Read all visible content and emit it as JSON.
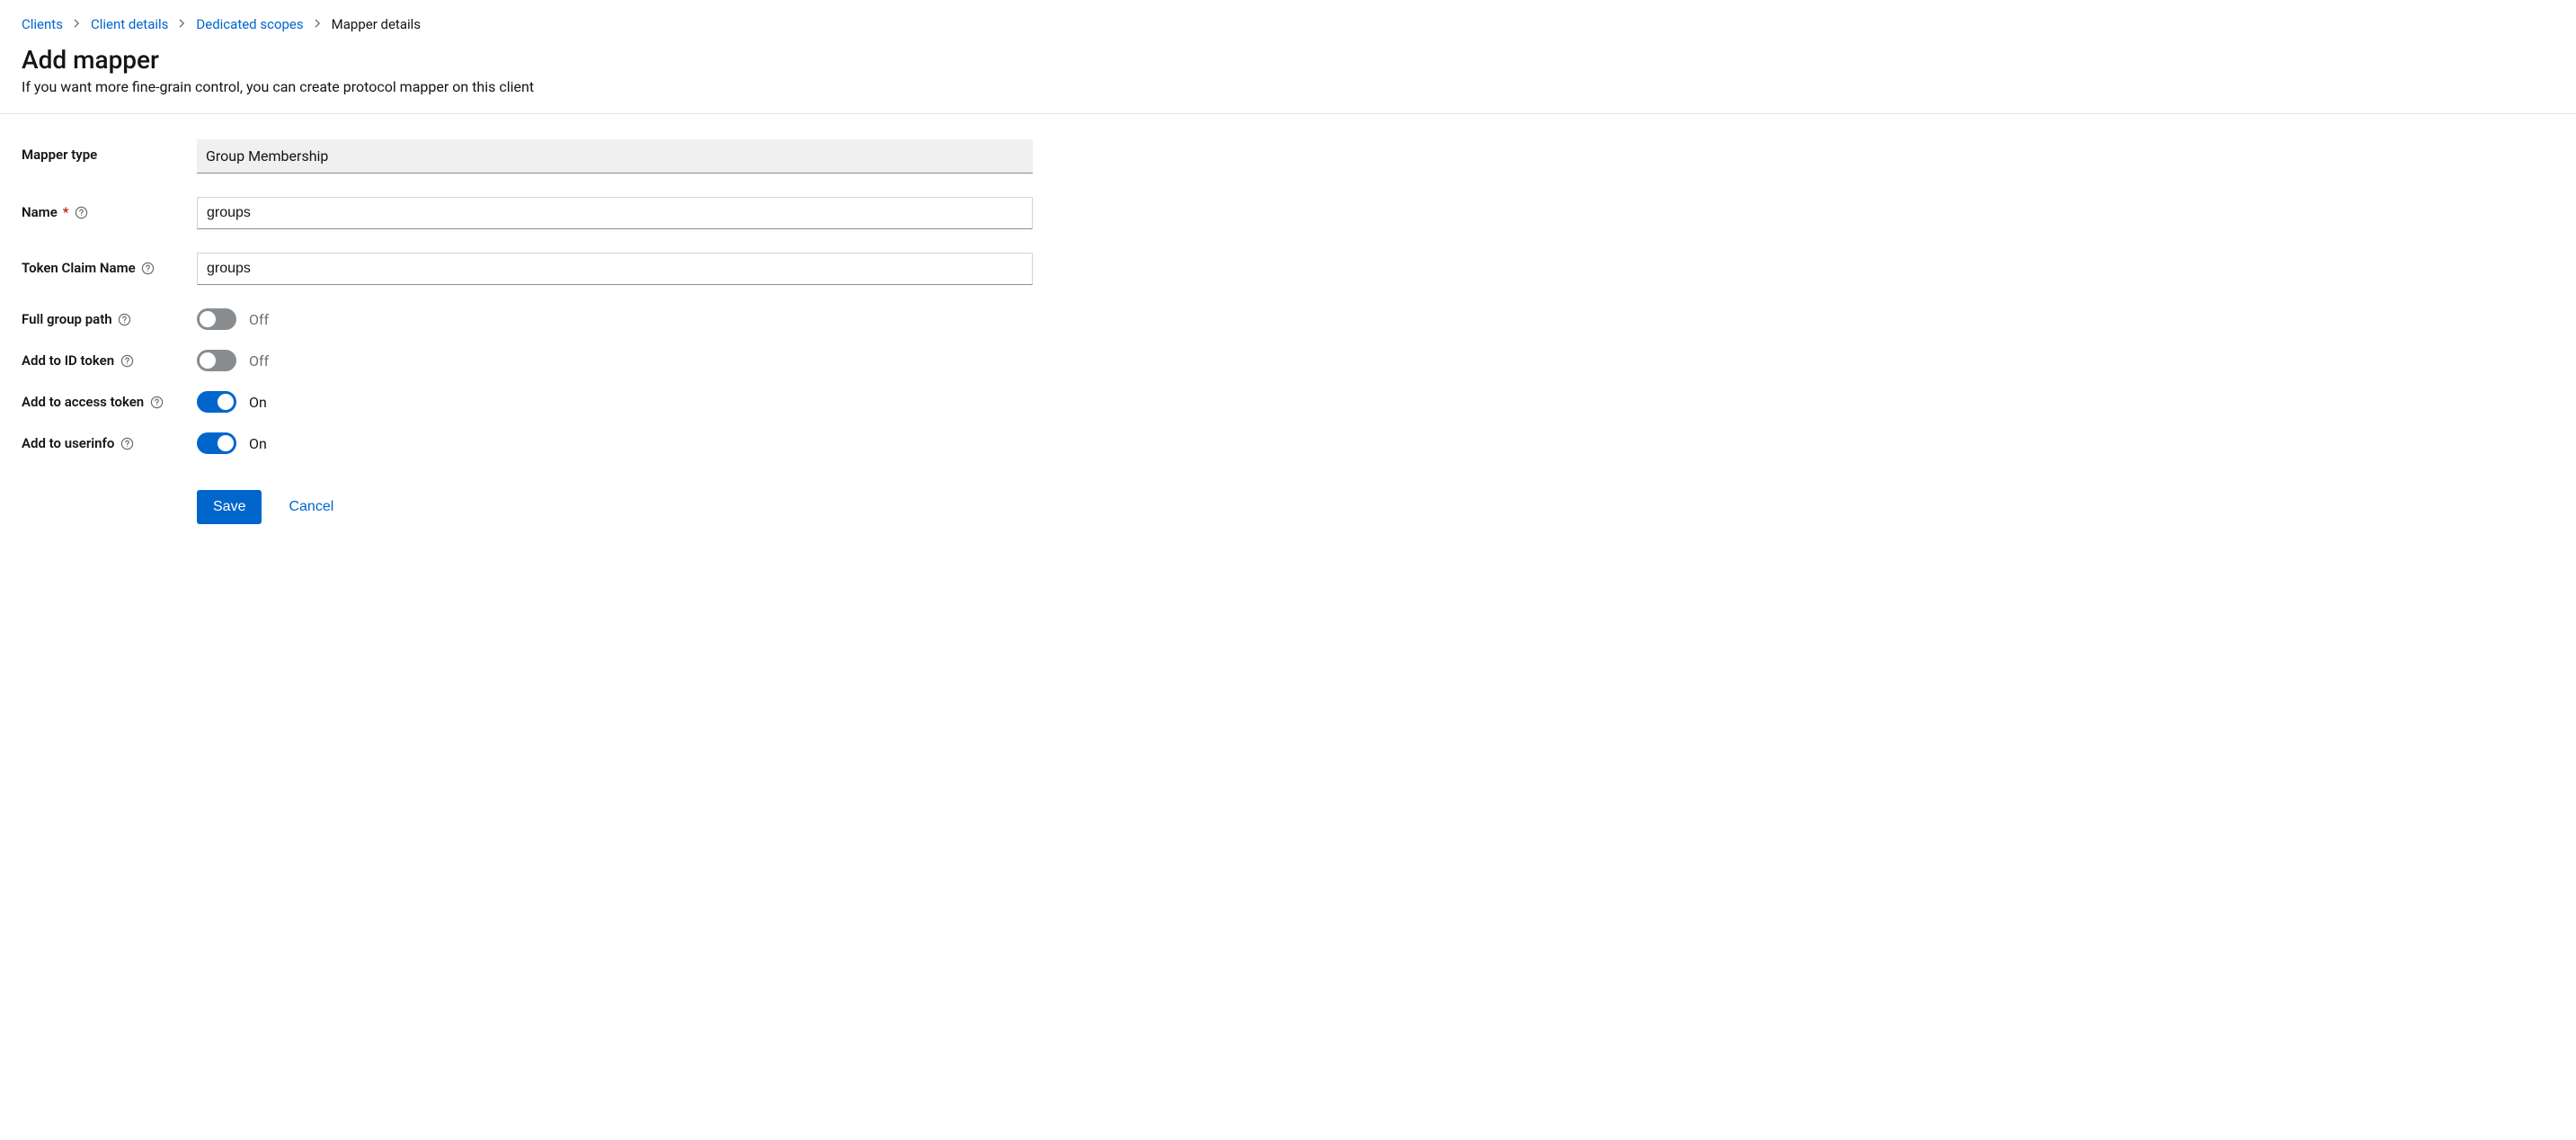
{
  "breadcrumb": {
    "items": [
      {
        "label": "Clients"
      },
      {
        "label": "Client details"
      },
      {
        "label": "Dedicated scopes"
      }
    ],
    "current": "Mapper details"
  },
  "page": {
    "title": "Add mapper",
    "description": "If you want more fine-grain control, you can create protocol mapper on this client"
  },
  "form": {
    "mapper_type": {
      "label": "Mapper type",
      "value": "Group Membership"
    },
    "name": {
      "label": "Name",
      "value": "groups"
    },
    "token_claim_name": {
      "label": "Token Claim Name",
      "value": "groups"
    },
    "full_group_path": {
      "label": "Full group path",
      "value": false,
      "text": "Off"
    },
    "add_to_id_token": {
      "label": "Add to ID token",
      "value": false,
      "text": "Off"
    },
    "add_to_access_token": {
      "label": "Add to access token",
      "value": true,
      "text": "On"
    },
    "add_to_userinfo": {
      "label": "Add to userinfo",
      "value": true,
      "text": "On"
    }
  },
  "actions": {
    "save": "Save",
    "cancel": "Cancel"
  }
}
